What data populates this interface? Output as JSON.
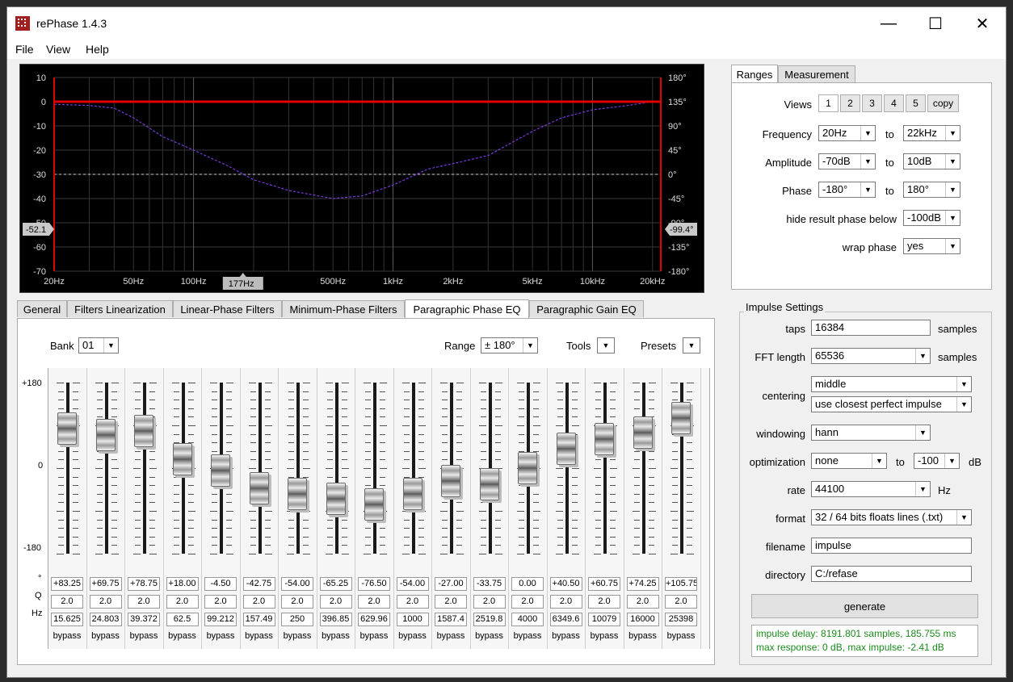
{
  "window": {
    "title": "rePhase 1.4.3",
    "minimize": "—",
    "maximize": "☐",
    "close": "✕"
  },
  "menu": {
    "file": "File",
    "view": "View",
    "help": "Help"
  },
  "plot": {
    "y_left": [
      "10",
      "0",
      "-10",
      "-20",
      "-30",
      "-40",
      "-50",
      "-60",
      "-70"
    ],
    "y_right": [
      "180°",
      "135°",
      "90°",
      "45°",
      "0°",
      "-45°",
      "-90°",
      "-135°",
      "-180°"
    ],
    "x_ticks": [
      "20Hz",
      "50Hz",
      "100Hz",
      "500Hz",
      "1kHz",
      "2kHz",
      "5kHz",
      "10kHz",
      "20kHz"
    ],
    "x_ticks_hz": [
      20,
      50,
      100,
      500,
      1000,
      2000,
      5000,
      10000,
      20000
    ],
    "cursor_freq": "177Hz",
    "cursor_freq_hz": 177,
    "left_readout": "-52.1",
    "left_readout_db": -52.1,
    "right_readout": "-99.4°",
    "right_readout_deg": -99.4,
    "amplitude_db": 0,
    "phase_curve": [
      [
        20,
        130
      ],
      [
        30,
        128
      ],
      [
        40,
        123
      ],
      [
        50,
        105
      ],
      [
        70,
        70
      ],
      [
        100,
        45
      ],
      [
        150,
        15
      ],
      [
        200,
        -10
      ],
      [
        300,
        -30
      ],
      [
        500,
        -45
      ],
      [
        700,
        -40
      ],
      [
        1000,
        -20
      ],
      [
        1500,
        10
      ],
      [
        2000,
        20
      ],
      [
        3000,
        35
      ],
      [
        5000,
        80
      ],
      [
        7000,
        105
      ],
      [
        10000,
        120
      ],
      [
        15000,
        128
      ],
      [
        20000,
        135
      ]
    ],
    "colors": {
      "amplitude": "#e00000",
      "phase": "#7a3ad8",
      "zero_line": "#cccccc"
    }
  },
  "eq_tabs": [
    "General",
    "Filters Linearization",
    "Linear-Phase Filters",
    "Minimum-Phase Filters",
    "Paragraphic Phase EQ",
    "Paragraphic Gain EQ"
  ],
  "eq": {
    "bank_label": "Bank",
    "bank_value": "01",
    "range_label": "Range",
    "range_value": "± 180°",
    "tools_label": "Tools",
    "presets_label": "Presets",
    "scale_top": "+180",
    "scale_mid": "0",
    "scale_bottom": "-180",
    "row_deg": "°",
    "row_q": "Q",
    "row_hz": "Hz",
    "bands": [
      {
        "deg": "+83.25",
        "q": "2.0",
        "hz": "15.625",
        "bypass": "bypass",
        "v": 83.25
      },
      {
        "deg": "+69.75",
        "q": "2.0",
        "hz": "24.803",
        "bypass": "bypass",
        "v": 69.75
      },
      {
        "deg": "+78.75",
        "q": "2.0",
        "hz": "39.372",
        "bypass": "bypass",
        "v": 78.75
      },
      {
        "deg": "+18.00",
        "q": "2.0",
        "hz": "62.5",
        "bypass": "bypass",
        "v": 18
      },
      {
        "deg": "-4.50",
        "q": "2.0",
        "hz": "99.212",
        "bypass": "bypass",
        "v": -4.5
      },
      {
        "deg": "-42.75",
        "q": "2.0",
        "hz": "157.49",
        "bypass": "bypass",
        "v": -42.75
      },
      {
        "deg": "-54.00",
        "q": "2.0",
        "hz": "250",
        "bypass": "bypass",
        "v": -54
      },
      {
        "deg": "-65.25",
        "q": "2.0",
        "hz": "396.85",
        "bypass": "bypass",
        "v": -65.25
      },
      {
        "deg": "-76.50",
        "q": "2.0",
        "hz": "629.96",
        "bypass": "bypass",
        "v": -76.5
      },
      {
        "deg": "-54.00",
        "q": "2.0",
        "hz": "1000",
        "bypass": "bypass",
        "v": -54
      },
      {
        "deg": "-27.00",
        "q": "2.0",
        "hz": "1587.4",
        "bypass": "bypass",
        "v": -27
      },
      {
        "deg": "-33.75",
        "q": "2.0",
        "hz": "2519.8",
        "bypass": "bypass",
        "v": -33.75
      },
      {
        "deg": "0.00",
        "q": "2.0",
        "hz": "4000",
        "bypass": "bypass",
        "v": 0
      },
      {
        "deg": "+40.50",
        "q": "2.0",
        "hz": "6349.6",
        "bypass": "bypass",
        "v": 40.5
      },
      {
        "deg": "+60.75",
        "q": "2.0",
        "hz": "10079",
        "bypass": "bypass",
        "v": 60.75
      },
      {
        "deg": "+74.25",
        "q": "2.0",
        "hz": "16000",
        "bypass": "bypass",
        "v": 74.25
      },
      {
        "deg": "+105.75",
        "q": "2.0",
        "hz": "25398",
        "bypass": "bypass",
        "v": 105.75
      }
    ]
  },
  "ranges": {
    "tabs": [
      "Ranges",
      "Measurement"
    ],
    "views_label": "Views",
    "views": [
      "1",
      "2",
      "3",
      "4",
      "5"
    ],
    "copy": "copy",
    "to": "to",
    "frequency": {
      "label": "Frequency",
      "from": "20Hz",
      "to": "22kHz"
    },
    "amplitude": {
      "label": "Amplitude",
      "from": "-70dB",
      "to": "10dB"
    },
    "phase": {
      "label": "Phase",
      "from": "-180°",
      "to": "180°"
    },
    "hide": {
      "label": "hide result phase below",
      "value": "-100dB"
    },
    "wrap": {
      "label": "wrap phase",
      "value": "yes"
    }
  },
  "impulse": {
    "title": "Impulse Settings",
    "taps": {
      "label": "taps",
      "value": "16384",
      "unit": "samples"
    },
    "fft": {
      "label": "FFT length",
      "value": "65536",
      "unit": "samples"
    },
    "centering": {
      "label": "centering",
      "value1": "middle",
      "value2": "use closest perfect impulse"
    },
    "windowing": {
      "label": "windowing",
      "value": "hann"
    },
    "optimization": {
      "label": "optimization",
      "value": "none",
      "to": "to",
      "to_value": "-100",
      "unit": "dB"
    },
    "rate": {
      "label": "rate",
      "value": "44100",
      "unit": "Hz"
    },
    "format": {
      "label": "format",
      "value": "32 / 64 bits floats lines (.txt)"
    },
    "filename": {
      "label": "filename",
      "value": "impulse"
    },
    "directory": {
      "label": "directory",
      "value": "C:/refase"
    },
    "generate": "generate",
    "status_line1": "impulse delay: 8191.801 samples, 185.755 ms",
    "status_line2": "max response: 0 dB, max impulse: -2.41 dB"
  }
}
